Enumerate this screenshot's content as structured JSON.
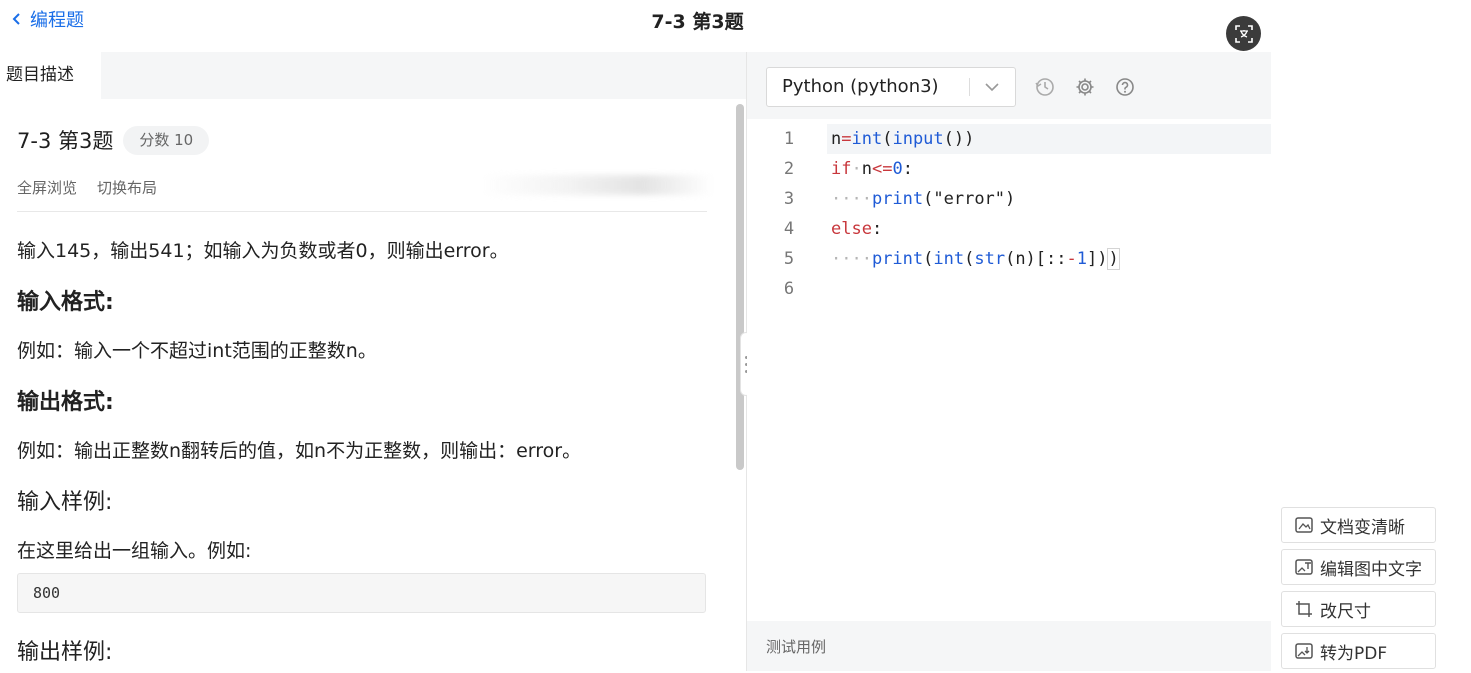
{
  "header": {
    "back_label": "编程题",
    "title": "7-3 第3题"
  },
  "left_panel": {
    "tab_label": "题目描述",
    "question_title": "7-3 第3题",
    "score_label": "分数 10",
    "links": [
      "全屏浏览",
      "切换布局"
    ],
    "description": "输入145，输出541；如输入为负数或者0，则输出error。",
    "input_format_heading": "输入格式:",
    "input_format_text": "例如：输入一个不超过int范围的正整数n。",
    "output_format_heading": "输出格式:",
    "output_format_text": "例如：输出正整数n翻转后的值，如n不为正整数，则输出：error。",
    "input_sample_heading": "输入样例:",
    "input_sample_text": "在这里给出一组输入。例如:",
    "input_sample_code": "800",
    "output_sample_heading": "输出样例:"
  },
  "editor": {
    "language": "Python (python3)",
    "line_numbers": [
      "1",
      "2",
      "3",
      "4",
      "5",
      "6"
    ],
    "code_lines": [
      "n=int(input())",
      "if n<=0:",
      "    print(\"error\")",
      "else:",
      "    print(int(str(n)[::-1]))",
      ""
    ],
    "test_cases_label": "测试用例"
  },
  "float_actions": {
    "clarify": "文档变清晰",
    "edit_text": "编辑图中文字",
    "resize": "改尺寸",
    "to_pdf": "转为PDF"
  },
  "colors": {
    "accent": "#1a6ee8",
    "keyword": "#c8373c",
    "function": "#1f5bd6"
  }
}
